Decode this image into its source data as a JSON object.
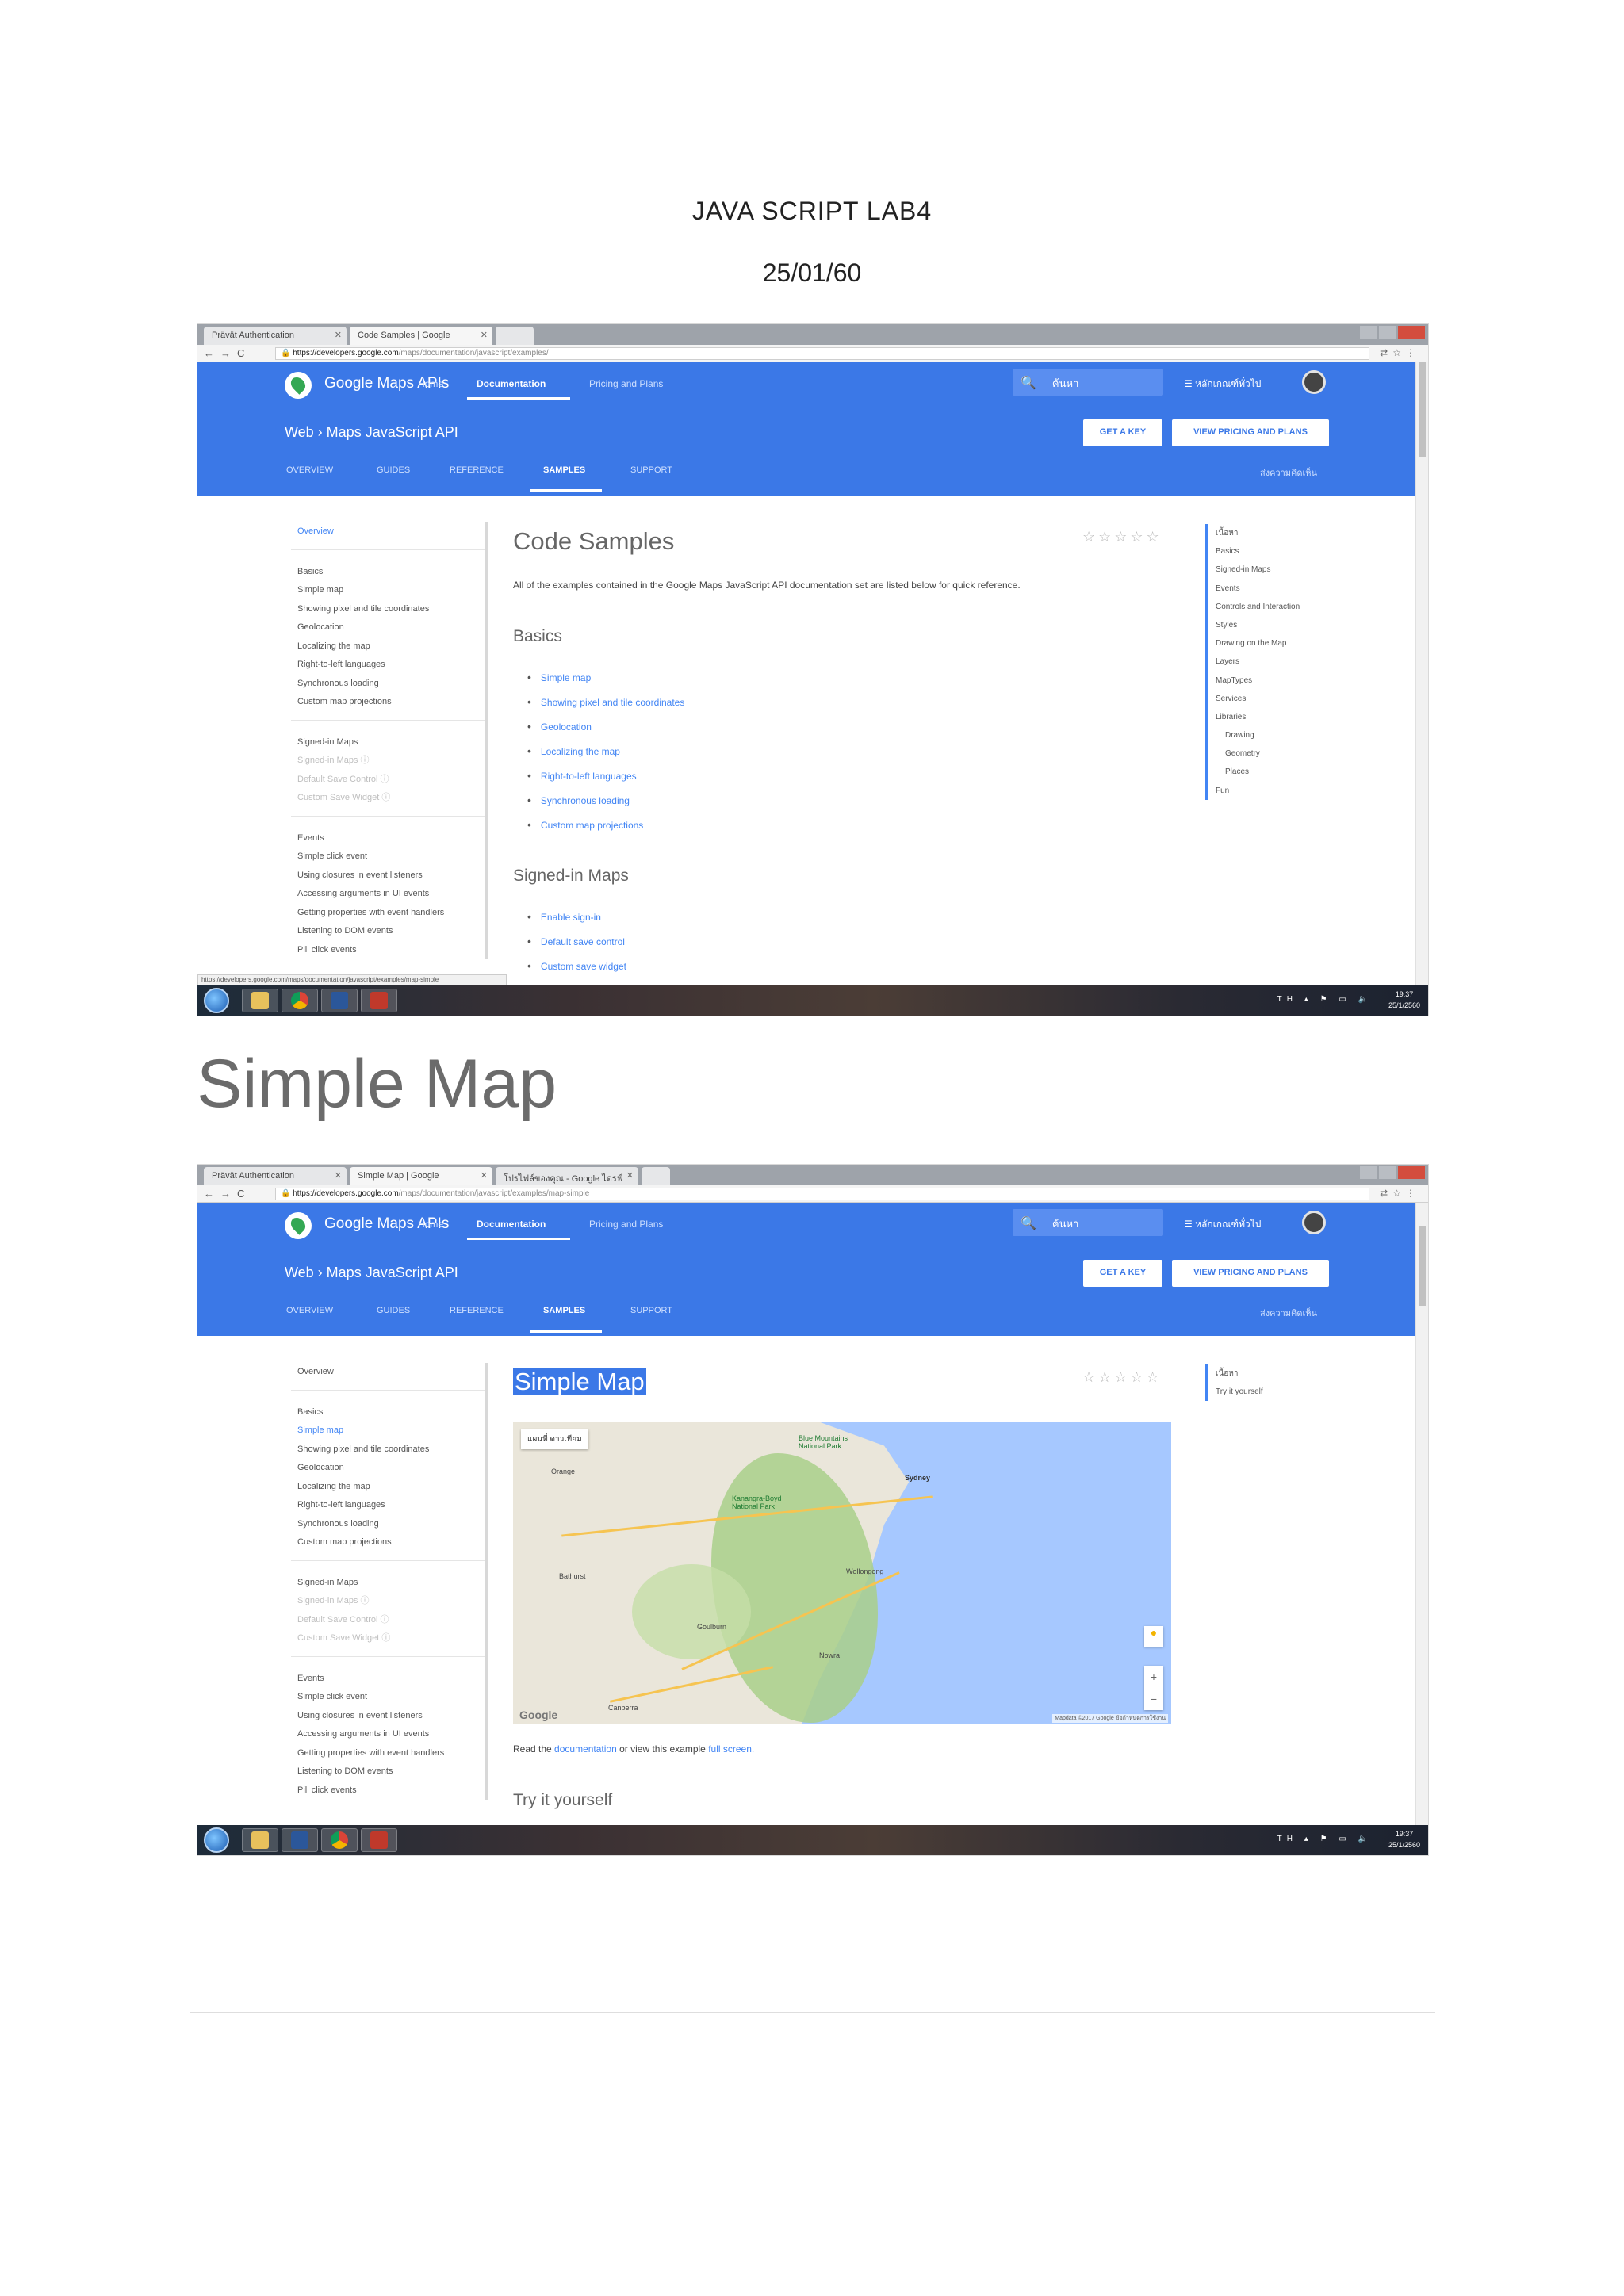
{
  "document": {
    "title": "JAVA SCRIPT LAB4",
    "date": "25/01/60",
    "section_heading": "Simple Map"
  },
  "common": {
    "brand": "Google Maps APIs",
    "nav": [
      "Home",
      "Documentation",
      "Pricing and Plans"
    ],
    "search_label": "ค้นหา",
    "language_menu": "☰ หลักเกณฑ์ทั่วไป",
    "breadcrumb": "Web  ›  Maps JavaScript API",
    "get_key": "GET A KEY",
    "view_plans": "VIEW PRICING AND PLANS",
    "subtabs": [
      "OVERVIEW",
      "GUIDES",
      "REFERENCE",
      "SAMPLES",
      "SUPPORT"
    ],
    "lang_select": "ส่งความคิดเห็น",
    "url_host": "https://developers.google.com",
    "tray_lang": "TH",
    "clock_time": "19:37",
    "clock_date": "25/1/2560"
  },
  "shot1": {
    "tabs": [
      "Prävät Authentication",
      "Code Samples | Google",
      ""
    ],
    "url_path": "/maps/documentation/javascript/examples/",
    "page_title": "Code Samples",
    "intro": "All of the examples contained in the Google Maps JavaScript API documentation set are listed below for quick reference.",
    "basics_heading": "Basics",
    "basics_links": [
      "Simple map",
      "Showing pixel and tile coordinates",
      "Geolocation",
      "Localizing the map",
      "Right-to-left languages",
      "Synchronous loading",
      "Custom map projections"
    ],
    "signedin_heading": "Signed-in Maps",
    "signedin_links": [
      "Enable sign-in",
      "Default save control",
      "Custom save widget"
    ],
    "status_url": "https://developers.google.com/maps/documentation/javascript/examples/map-simple",
    "rightnav": [
      "เนื้อหา",
      "Basics",
      "Signed-in Maps",
      "Events",
      "Controls and Interaction",
      "Styles",
      "Drawing on the Map",
      "Layers",
      "MapTypes",
      "Services",
      "Libraries",
      "Drawing",
      "Geometry",
      "Places",
      "Fun"
    ]
  },
  "leftnav": {
    "overview": "Overview",
    "group1": [
      "Basics",
      "Simple map",
      "Showing pixel and tile coordinates",
      "Geolocation",
      "Localizing the map",
      "Right-to-left languages",
      "Synchronous loading",
      "Custom map projections"
    ],
    "group2": [
      "Signed-in Maps",
      "Signed-in Maps ⓘ",
      "Default Save Control ⓘ",
      "Custom Save Widget ⓘ"
    ],
    "group3": [
      "Events",
      "Simple click event",
      "Using closures in event listeners",
      "Accessing arguments in UI events",
      "Getting properties with event handlers",
      "Listening to DOM events",
      "Pill click events"
    ]
  },
  "shot2": {
    "tabs": [
      "Prävät Authentication",
      "Simple Map | Google",
      "โปรไฟล์ของคุณ - Google ไดรฟ์"
    ],
    "url_path": "/maps/documentation/javascript/examples/map-simple",
    "page_title": "Simple Map",
    "map_types": "แผนที่   ดาวเทียม",
    "map_labels": {
      "sydney": "Sydney",
      "wollongong": "Wollongong",
      "goulburn": "Goulburn",
      "canberra": "Canberra",
      "orange": "Orange",
      "nowra": "Nowra",
      "bathurst": "Bathurst",
      "blue_mountains": "Blue Mountains National Park",
      "kanangra": "Kanangra-Boyd National Park"
    },
    "google_logo": "Google",
    "map_attrib": "Mapdata ©2017 Google  ข้อกำหนดการใช้งาน",
    "read_prefix": "Read the",
    "read_link1": "documentation",
    "read_middle": "or view this example",
    "read_link2": "full screen.",
    "try_heading": "Try it yourself",
    "rightnav": [
      "เนื้อหา",
      "Try it yourself"
    ]
  }
}
